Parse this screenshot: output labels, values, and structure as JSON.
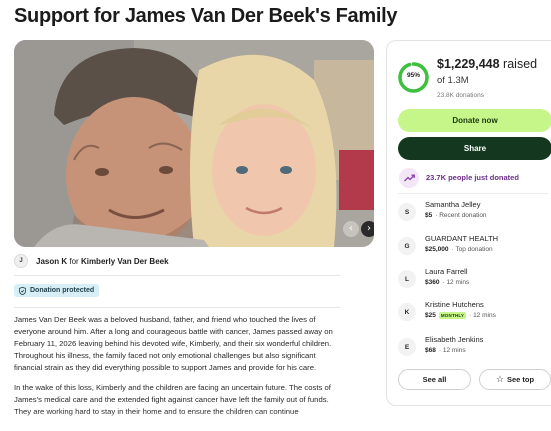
{
  "page": {
    "title": "Support for James Van Der Beek's Family"
  },
  "organizer": {
    "initial": "J",
    "name": "Jason K",
    "connector": "for",
    "beneficiary": "Kimberly Van Der Beek"
  },
  "badge": {
    "label": "Donation protected"
  },
  "story": {
    "paragraphs": [
      "James Van Der Beek was a beloved husband, father, and friend who touched the lives of everyone around him. After a long and courageous battle with cancer, James passed away on February 11, 2026 leaving behind his devoted wife, Kimberly, and their six wonderful children. Throughout his illness, the family faced not only emotional challenges but also significant financial strain as they did everything possible to support James and provide for his care.",
      "In the wake of this loss, Kimberly and the children are facing an uncertain future. The costs of James's medical care and the extended fight against cancer have left the family out of funds. They are working hard to stay in their home and to ensure the children can continue"
    ]
  },
  "progress": {
    "percent_label": "95%",
    "percent": 0.95,
    "amount": "$1,229,448",
    "amount_suffix": "raised",
    "goal": "of 1.3M",
    "donations": "23.8K donations"
  },
  "actions": {
    "donate": "Donate now",
    "share": "Share"
  },
  "trending": {
    "text": "23.7K people just donated"
  },
  "donors": [
    {
      "initial": "S",
      "name": "Samantha Jelley",
      "amount": "$5",
      "note": "· Recent donation",
      "monthly": ""
    },
    {
      "initial": "G",
      "name": "GUARDANT HEALTH",
      "amount": "$25,000",
      "note": "· Top donation",
      "monthly": ""
    },
    {
      "initial": "L",
      "name": "Laura Farrell",
      "amount": "$360",
      "note": "· 12 mins",
      "monthly": ""
    },
    {
      "initial": "K",
      "name": "Kristine Hutchens",
      "amount": "$25",
      "note": "· 12 mins",
      "monthly": "MONTHLY"
    },
    {
      "initial": "E",
      "name": "Elisabeth Jenkins",
      "amount": "$68",
      "note": "· 12 mins",
      "monthly": ""
    }
  ],
  "list_actions": {
    "see_all": "See all",
    "see_top": "See top"
  },
  "colors": {
    "accent_green": "#c6f58a",
    "dark_green": "#14381f",
    "ring_green": "#3fbf3f",
    "trend_purple": "#6d2e8a",
    "badge_blue": "#d7eef6"
  },
  "icons": {
    "shield": "shield-check-icon",
    "trend": "trending-up-icon",
    "star": "star-outline-icon",
    "prev": "chevron-left-icon",
    "next": "chevron-right-icon"
  }
}
